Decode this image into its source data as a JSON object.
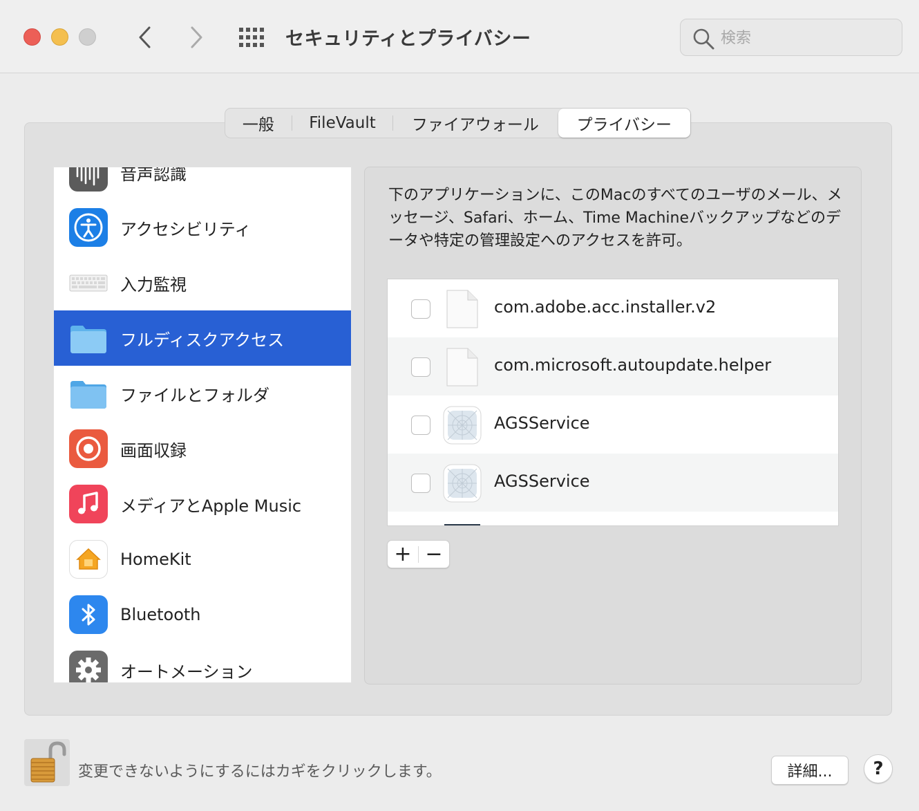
{
  "window": {
    "title": "セキュリティとプライバシー",
    "search_placeholder": "検索"
  },
  "tabs": [
    {
      "label": "一般"
    },
    {
      "label": "FileVault"
    },
    {
      "label": "ファイアウォール"
    },
    {
      "label": "プライバシー",
      "selected": true
    }
  ],
  "sidebar": {
    "items": [
      {
        "label": "音声認識",
        "icon": "waveform-icon"
      },
      {
        "label": "アクセシビリティ",
        "icon": "accessibility-icon"
      },
      {
        "label": "入力監視",
        "icon": "keyboard-icon"
      },
      {
        "label": "フルディスクアクセス",
        "icon": "folder-icon",
        "selected": true
      },
      {
        "label": "ファイルとフォルダ",
        "icon": "folder-icon"
      },
      {
        "label": "画面収録",
        "icon": "screen-record-icon"
      },
      {
        "label": "メディアとApple Music",
        "icon": "music-icon"
      },
      {
        "label": "HomeKit",
        "icon": "home-icon"
      },
      {
        "label": "Bluetooth",
        "icon": "bluetooth-icon"
      },
      {
        "label": "オートメーション",
        "icon": "gear-icon"
      }
    ]
  },
  "main": {
    "description": "下のアプリケーションに、このMacのすべてのユーザのメール、メッセージ、Safari、ホーム、Time Machineバックアップなどのデータや特定の管理設定へのアクセスを許可。",
    "apps": [
      {
        "name": "com.adobe.acc.installer.v2",
        "icon": "document-icon",
        "checked": false
      },
      {
        "name": "com.microsoft.autoupdate.helper",
        "icon": "document-icon",
        "checked": false
      },
      {
        "name": "AGSService",
        "icon": "app-placeholder-icon",
        "checked": false
      },
      {
        "name": "AGSService",
        "icon": "app-placeholder-icon",
        "checked": false
      }
    ],
    "add_label": "+",
    "remove_label": "−"
  },
  "footer": {
    "lock_text": "変更できないようにするにはカギをクリックします。",
    "advanced_label": "詳細...",
    "help_label": "?"
  },
  "colors": {
    "selection": "#2860d4",
    "close": "#ec5f57",
    "minimize": "#f4bf4f"
  }
}
